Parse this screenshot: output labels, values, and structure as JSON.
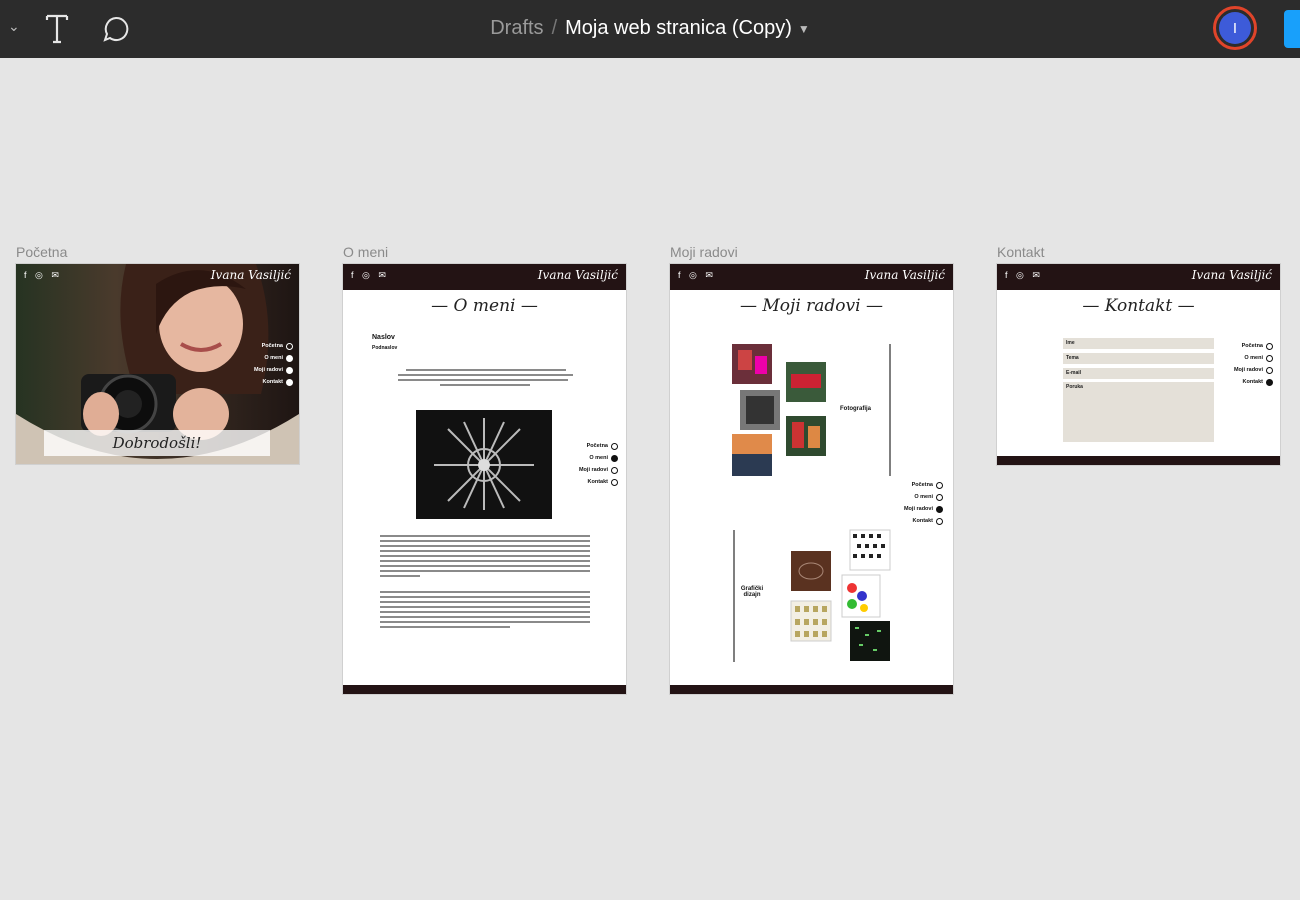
{
  "toolbar": {
    "breadcrumb": {
      "folder": "Drafts",
      "separator": "/",
      "file": "Moja web stranica (Copy)"
    },
    "avatar_initial": "I",
    "icons": [
      "chevron-down-icon",
      "text-tool-icon",
      "comment-tool-icon"
    ]
  },
  "frames": [
    {
      "label": "Početna",
      "signature": "Ivana Vasiljić",
      "welcome": "Dobrodošli!",
      "nav": [
        "Početna",
        "O meni",
        "Moji radovi",
        "Kontakt"
      ]
    },
    {
      "label": "O meni",
      "signature": "Ivana Vasiljić",
      "heading": "— O meni —",
      "name": "Naslov",
      "subtitle": "Podnaslov",
      "nav": [
        "Početna",
        "O meni",
        "Moji radovi",
        "Kontakt"
      ]
    },
    {
      "label": "Moji radovi",
      "signature": "Ivana Vasiljić",
      "heading": "— Moji radovi —",
      "section_photo": "Fotografija",
      "section_design": "Grafički dizajn",
      "nav": [
        "Početna",
        "O meni",
        "Moji radovi",
        "Kontakt"
      ]
    },
    {
      "label": "Kontakt",
      "signature": "Ivana Vasiljić",
      "heading": "— Kontakt —",
      "fields": [
        "Ime",
        "Tema",
        "E-mail",
        "Poruka"
      ],
      "nav": [
        "Početna",
        "O meni",
        "Moji radovi",
        "Kontakt"
      ]
    }
  ],
  "colors": {
    "topbar": "#2c2c2c",
    "canvas": "#e5e5e5",
    "frame_header": "#231314",
    "avatar": "#3d5bd9",
    "avatar_ring": "#e0442a",
    "share": "#18a0fb"
  }
}
